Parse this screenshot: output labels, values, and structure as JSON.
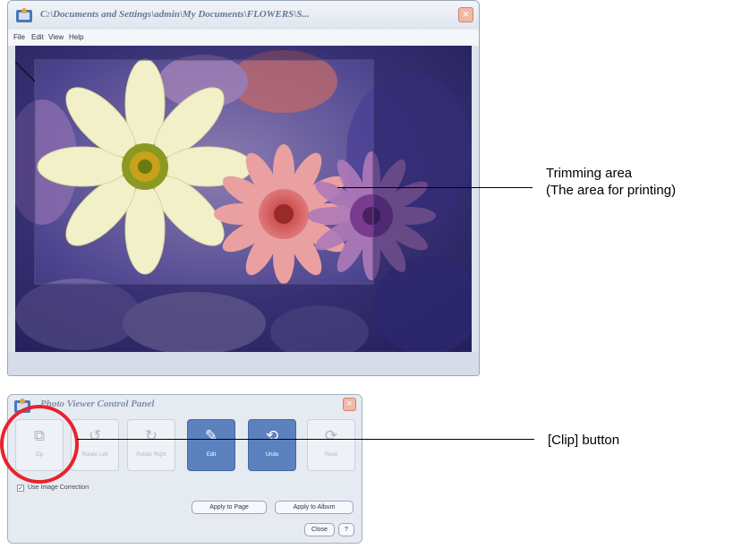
{
  "viewer": {
    "title": "C:\\Documents and Settings\\admin\\My Documents\\FLOWERS\\S...",
    "menu": [
      "File",
      "Edit",
      "View",
      "Help"
    ]
  },
  "control_panel": {
    "title": "Photo Viewer Control Panel",
    "tools": [
      {
        "label": "Zip",
        "icon": "clip-icon",
        "state": "disabled"
      },
      {
        "label": "Rotate Left",
        "icon": "rotate-left-icon",
        "state": "disabled"
      },
      {
        "label": "Rotate Right",
        "icon": "rotate-right-icon",
        "state": "disabled"
      },
      {
        "label": "Edit",
        "icon": "edit-icon",
        "state": "enabled"
      },
      {
        "label": "Undo",
        "icon": "undo-icon",
        "state": "enabled"
      },
      {
        "label": "Redo",
        "icon": "redo-icon",
        "state": "disabled"
      }
    ],
    "use_image_correction": "Use Image Correction",
    "use_image_correction_checked": true,
    "apply_to_page": "Apply to Page",
    "apply_to_album": "Apply to Album",
    "close": "Close",
    "help": "?"
  },
  "callouts": {
    "trimming_area_line1": "Trimming area",
    "trimming_area_line2": "(The area for printing)",
    "clip_button": "[Clip] button"
  },
  "colors": {
    "accent": "#5b82bf",
    "highlight_ring": "#e8232e"
  }
}
